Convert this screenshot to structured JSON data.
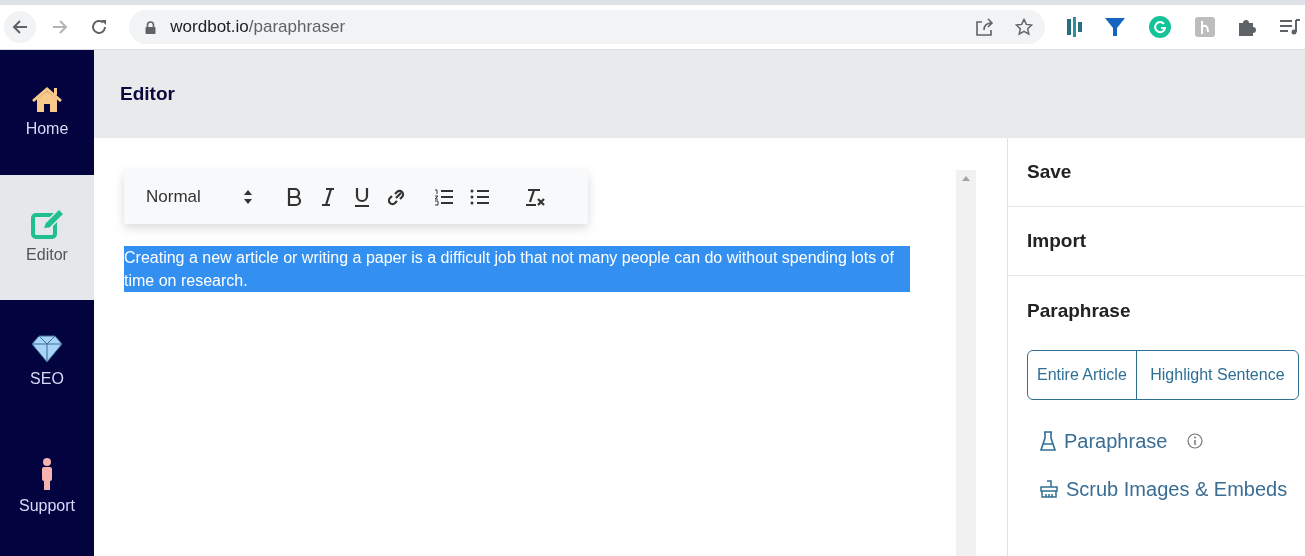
{
  "browser": {
    "url_host": "wordbot.io",
    "url_path": "/paraphraser"
  },
  "sidebar": {
    "items": [
      {
        "kind": "home",
        "label": "Home",
        "selected": false
      },
      {
        "kind": "editor",
        "label": "Editor",
        "selected": true
      },
      {
        "kind": "seo",
        "label": "SEO",
        "selected": false
      },
      {
        "kind": "support",
        "label": "Support",
        "selected": false
      }
    ]
  },
  "header": {
    "title": "Editor"
  },
  "toolbar": {
    "format": "Normal"
  },
  "editor": {
    "text": "Creating a new article or writing a paper is a difficult job that not many people can do without spending lots of time on research."
  },
  "panel": {
    "sections": [
      "Save",
      "Import",
      "Paraphrase"
    ],
    "modes": [
      "Entire Article",
      "Highlight Sentence"
    ],
    "actions": [
      {
        "kind": "paraphrase",
        "label": "Paraphrase",
        "info": true
      },
      {
        "kind": "scrub",
        "label": "Scrub Images & Embeds",
        "info": false
      }
    ]
  }
}
